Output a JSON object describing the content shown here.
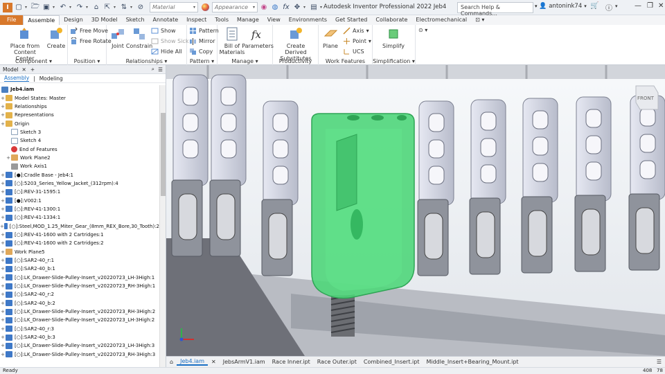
{
  "app_title": "Autodesk Inventor Professional 2022   Jeb4",
  "search_placeholder": "Search Help & Commands...",
  "user_name": "antonink74",
  "material_combo": "Material",
  "appearance_combo": "Appearance",
  "tabs": [
    "File",
    "Assemble",
    "Design",
    "3D Model",
    "Sketch",
    "Annotate",
    "Inspect",
    "Tools",
    "Manage",
    "View",
    "Environments",
    "Get Started",
    "Collaborate",
    "Electromechanical"
  ],
  "ribbon": {
    "place_from_content_center": "Place from Content Center",
    "create": "Create",
    "free_move": "Free Move",
    "free_rotate": "Free Rotate",
    "joint": "Joint",
    "constrain": "Constrain",
    "show": "Show",
    "show_sick": "Show Sick",
    "hide_all": "Hide All",
    "pattern": "Pattern",
    "mirror": "Mirror",
    "copy": "Copy",
    "bill_of_materials": "Bill of Materials",
    "parameters": "Parameters",
    "create_derived_substitutes": "Create Derived Substitutes",
    "plane": "Plane",
    "axis": "Axis",
    "point": "Point",
    "ucs": "UCS",
    "simplify": "Simplify",
    "groups": [
      "Component",
      "Position",
      "Relationships",
      "Pattern",
      "Manage",
      "Productivity",
      "Work Features",
      "Simplification"
    ]
  },
  "browser": {
    "title": "Model",
    "assembly_tab": "Assembly",
    "modeling_tab": "Modeling",
    "items": [
      {
        "label": "Jeb4.iam",
        "icon": "assembly",
        "color": "#4a7fc1"
      },
      {
        "label": "Model States: Master",
        "icon": "folder",
        "color": "#e3b24a"
      },
      {
        "label": "Relationships",
        "icon": "folder",
        "color": "#e3b24a"
      },
      {
        "label": "Representations",
        "icon": "folder",
        "color": "#e3b24a"
      },
      {
        "label": "Origin",
        "icon": "folder",
        "color": "#e3b24a"
      },
      {
        "label": "Sketch 3",
        "icon": "sketch",
        "color": "#8aa0b8"
      },
      {
        "label": "Sketch 4",
        "icon": "sketch",
        "color": "#8aa0b8"
      },
      {
        "label": "End of Features",
        "icon": "end",
        "color": "#d93a3a"
      },
      {
        "label": "Work Plane2",
        "icon": "plane",
        "color": "#e0a85a"
      },
      {
        "label": "Work Axis1",
        "icon": "axis",
        "color": "#9a9a9a"
      },
      {
        "label": "[●]:Cradle Base - Jeb4:1",
        "icon": "part",
        "color": "#3e78c7"
      },
      {
        "label": "[○]:5203_Series_Yellow_Jacket_(312rpm):4",
        "icon": "part",
        "color": "#3e78c7"
      },
      {
        "label": "[○]:REV-31-1595:1",
        "icon": "part",
        "color": "#3e78c7"
      },
      {
        "label": "[●]:V002:1",
        "icon": "part",
        "color": "#3e78c7"
      },
      {
        "label": "[○]:REV-41-1300:1",
        "icon": "part",
        "color": "#3e78c7"
      },
      {
        "label": "[○]:REV-41-1334:1",
        "icon": "part",
        "color": "#3e78c7"
      },
      {
        "label": "[○]:Steel,MOD_1.25_Miter_Gear_(8mm_REX_Bore,30_Tooth):2",
        "icon": "part",
        "color": "#3e78c7"
      },
      {
        "label": "[○]:REV-41-1600 with 2 Cartridges:1",
        "icon": "part",
        "color": "#3e78c7"
      },
      {
        "label": "[○]:REV-41-1600 with 2 Cartridges:2",
        "icon": "part",
        "color": "#3e78c7"
      },
      {
        "label": "Work Plane5",
        "icon": "plane",
        "color": "#e0a85a"
      },
      {
        "label": "[○]:SAR2-40_r:1",
        "icon": "part",
        "color": "#3e78c7"
      },
      {
        "label": "[○]:SAR2-40_b:1",
        "icon": "part",
        "color": "#3e78c7"
      },
      {
        "label": "[○]:LK_Drawer-Slide-Pulley-Insert_v20220723_LH-3High:1",
        "icon": "part",
        "color": "#3e78c7"
      },
      {
        "label": "[○]:LK_Drawer-Slide-Pulley-Insert_v20220723_RH-3High:1",
        "icon": "part",
        "color": "#3e78c7"
      },
      {
        "label": "[○]:SAR2-40_r:2",
        "icon": "part",
        "color": "#3e78c7"
      },
      {
        "label": "[○]:SAR2-40_b:2",
        "icon": "part",
        "color": "#3e78c7"
      },
      {
        "label": "[○]:LK_Drawer-Slide-Pulley-Insert_v20220723_RH-3High:2",
        "icon": "part",
        "color": "#3e78c7"
      },
      {
        "label": "[○]:LK_Drawer-Slide-Pulley-Insert_v20220723_LH-3High:2",
        "icon": "part",
        "color": "#3e78c7"
      },
      {
        "label": "[○]:SAR2-40_r:3",
        "icon": "part",
        "color": "#3e78c7"
      },
      {
        "label": "[○]:SAR2-40_b:3",
        "icon": "part",
        "color": "#3e78c7"
      },
      {
        "label": "[○]:LK_Drawer-Slide-Pulley-Insert_v20220723_LH-3High:3",
        "icon": "part",
        "color": "#3e78c7"
      },
      {
        "label": "[○]:LK_Drawer-Slide-Pulley-Insert_v20220723_RH-3High:3",
        "icon": "part",
        "color": "#3e78c7"
      }
    ]
  },
  "view_cube_label": "FRONT",
  "doc_tabs": [
    "Jeb4.iam",
    "JebsArmV1.iam",
    "Race Inner.ipt",
    "Race Outer.ipt",
    "Combined_Insert.ipt",
    "Middle_Insert+Bearing_Mount.ipt"
  ],
  "status": {
    "left": "Ready",
    "count_a": "408",
    "count_b": "78"
  },
  "colors": {
    "accent": "#d8782b",
    "selection": "#4fd67a",
    "part_body": "#d9dbe8"
  }
}
